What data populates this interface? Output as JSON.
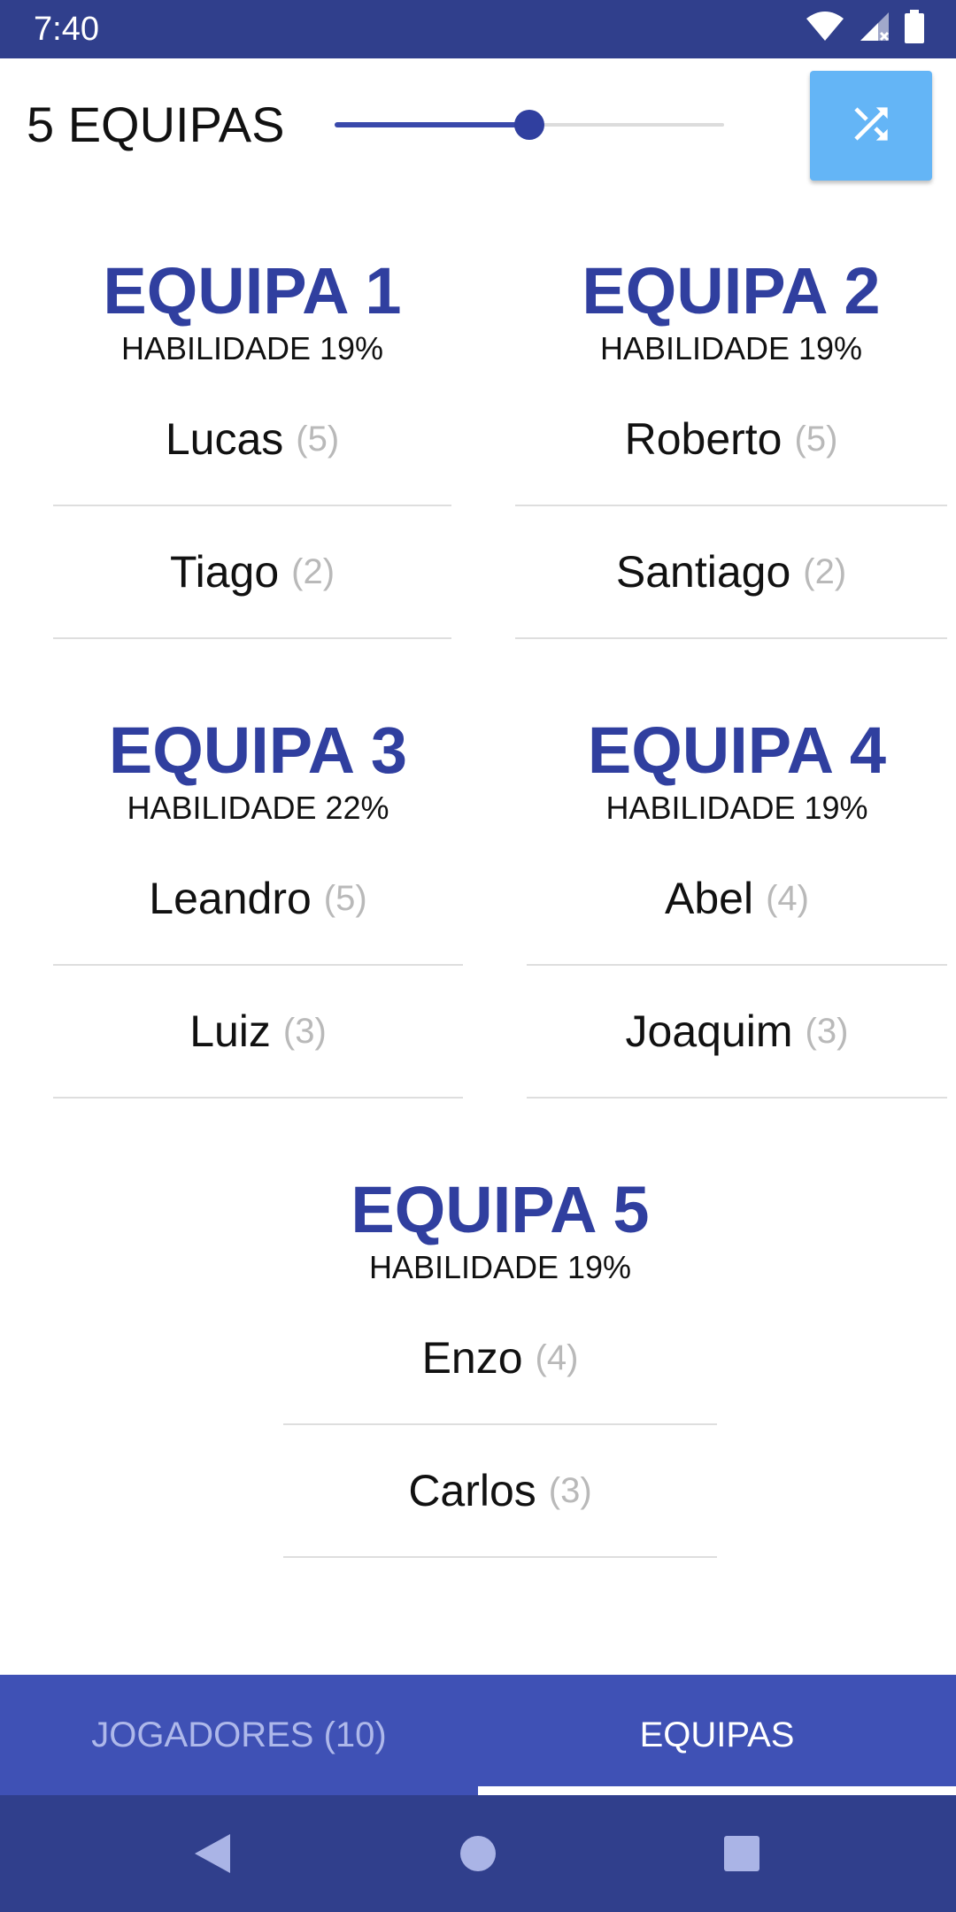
{
  "status_bar": {
    "time": "7:40",
    "icons": [
      "wifi-icon",
      "cell-signal-icon",
      "battery-icon"
    ]
  },
  "controls": {
    "team_count_label": "5 EQUIPAS",
    "slider_value_fraction": 0.5,
    "shuffle_icon": "shuffle-icon"
  },
  "teams": [
    {
      "title": "EQUIPA 1",
      "skill": "HABILIDADE 19%",
      "players": [
        {
          "name": "Lucas",
          "rating": "(5)"
        },
        {
          "name": "Tiago",
          "rating": "(2)"
        }
      ]
    },
    {
      "title": "EQUIPA 2",
      "skill": "HABILIDADE 19%",
      "players": [
        {
          "name": "Roberto",
          "rating": "(5)"
        },
        {
          "name": "Santiago",
          "rating": "(2)"
        }
      ]
    },
    {
      "title": "EQUIPA 3",
      "skill": "HABILIDADE 22%",
      "players": [
        {
          "name": "Leandro",
          "rating": "(5)"
        },
        {
          "name": "Luiz",
          "rating": "(3)"
        }
      ]
    },
    {
      "title": "EQUIPA 4",
      "skill": "HABILIDADE 19%",
      "players": [
        {
          "name": "Abel",
          "rating": "(4)"
        },
        {
          "name": "Joaquim",
          "rating": "(3)"
        }
      ]
    },
    {
      "title": "EQUIPA 5",
      "skill": "HABILIDADE 19%",
      "players": [
        {
          "name": "Enzo",
          "rating": "(4)"
        },
        {
          "name": "Carlos",
          "rating": "(3)"
        }
      ]
    }
  ],
  "tabs": [
    {
      "label": "JOGADORES (10)",
      "selected": false
    },
    {
      "label": "EQUIPAS",
      "selected": true
    }
  ],
  "colors": {
    "primary_dark": "#303f8c",
    "primary": "#3f51b5",
    "team_title": "#303f9f",
    "shuffle_button": "#64b5f6"
  },
  "nav": [
    "back-icon",
    "home-icon",
    "recents-icon"
  ]
}
